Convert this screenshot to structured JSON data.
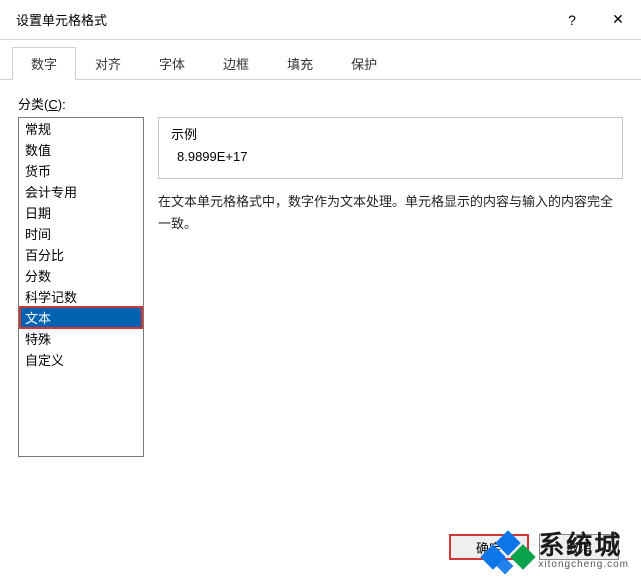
{
  "title": "设置单元格格式",
  "tabs": [
    "数字",
    "对齐",
    "字体",
    "边框",
    "填充",
    "保护"
  ],
  "active_tab_index": 0,
  "category_label_pre": "分类(",
  "category_label_u": "C",
  "category_label_post": "):",
  "categories": [
    "常规",
    "数值",
    "货币",
    "会计专用",
    "日期",
    "时间",
    "百分比",
    "分数",
    "科学记数",
    "文本",
    "特殊",
    "自定义"
  ],
  "selected_category_index": 9,
  "sample": {
    "title": "示例",
    "value": "8.9899E+17"
  },
  "description": "在文本单元格格式中，数字作为文本处理。单元格显示的内容与输入的内容完全一致。",
  "buttons": {
    "ok": "确定",
    "cancel": "取消"
  },
  "watermark": {
    "big": "系统城",
    "small": "xitongcheng.com"
  }
}
